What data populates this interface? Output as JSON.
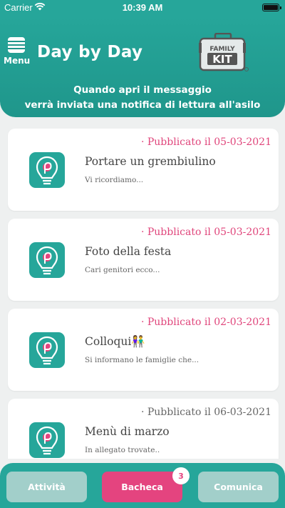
{
  "status_bar": {
    "carrier": "Carrier",
    "time": "10:39 AM"
  },
  "header": {
    "menu_label": "Menu",
    "title": "Day by Day",
    "logo_text_top": "FAMILY",
    "logo_text_bottom": "KIT",
    "subtitle_line1": "Quando apri il messaggio",
    "subtitle_line2": "verrà inviata una notifica di lettura all'asilo"
  },
  "posts": [
    {
      "date": "· Pubblicato il 05-03-2021",
      "title": "Portare un grembiulino",
      "excerpt": "Vi ricordiamo..."
    },
    {
      "date": "· Pubblicato il 05-03-2021",
      "title": "Foto della festa",
      "excerpt": "Cari genitori ecco..."
    },
    {
      "date": "· Pubblicato il 02-03-2021",
      "title": "Colloqui👫",
      "excerpt": "Si informano le famiglie che..."
    },
    {
      "date": "· Pubblicato il 06-03-2021",
      "title": "Menù di marzo",
      "excerpt": "In allegato trovate.."
    }
  ],
  "tabs": {
    "attivita": "Attività",
    "bacheca": "Bacheca",
    "comunica": "Comunica",
    "bacheca_badge": "3"
  },
  "colors": {
    "teal": "#26a69a",
    "pink": "#e4447f",
    "tab_inactive": "#a2cfca"
  }
}
